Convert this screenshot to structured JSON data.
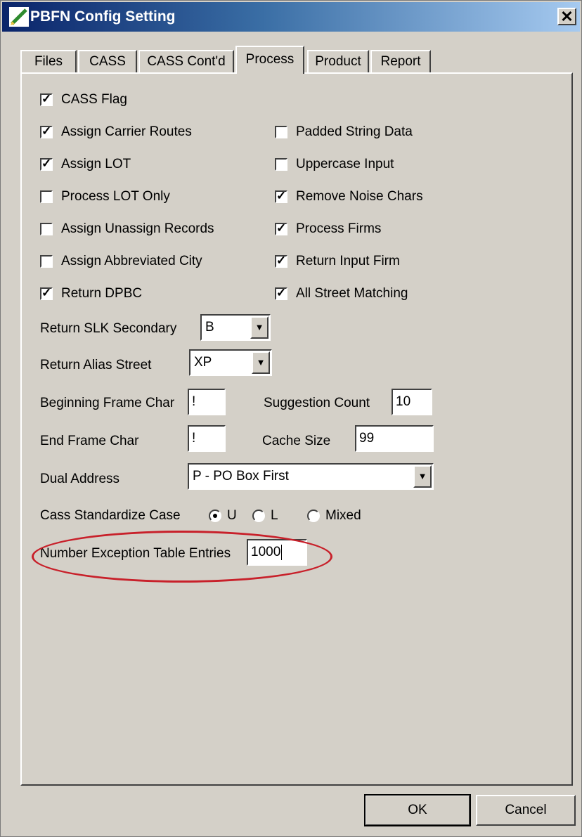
{
  "window": {
    "title": "PBFN Config Setting",
    "close_glyph": "✕"
  },
  "tabs": [
    {
      "label": "Files"
    },
    {
      "label": "CASS"
    },
    {
      "label": "CASS Cont'd"
    },
    {
      "label": "Process"
    },
    {
      "label": "Product"
    },
    {
      "label": "Report"
    }
  ],
  "active_tab": "Process",
  "checkboxes_left": [
    {
      "label": "CASS Flag",
      "checked": true,
      "mark": "✓"
    },
    {
      "label": "Assign Carrier Routes",
      "checked": true,
      "mark": "✓"
    },
    {
      "label": "Assign LOT",
      "checked": true,
      "mark": "✓"
    },
    {
      "label": "Process LOT Only",
      "checked": false,
      "mark": ""
    },
    {
      "label": "Assign Unassign Records",
      "checked": false,
      "mark": ""
    },
    {
      "label": "Assign Abbreviated City",
      "checked": false,
      "mark": ""
    },
    {
      "label": "Return DPBC",
      "checked": true,
      "mark": "✓"
    }
  ],
  "checkboxes_right": [
    {
      "label": "Padded String Data",
      "checked": false,
      "mark": ""
    },
    {
      "label": "Uppercase Input",
      "checked": false,
      "mark": ""
    },
    {
      "label": "Remove Noise Chars",
      "checked": true,
      "mark": "✓"
    },
    {
      "label": "Process Firms",
      "checked": true,
      "mark": "✓"
    },
    {
      "label": "Return Input Firm",
      "checked": true,
      "mark": "✓"
    },
    {
      "label": "All Street Matching",
      "checked": true,
      "mark": "✓"
    }
  ],
  "fields": {
    "return_slk_secondary": {
      "label": "Return SLK Secondary",
      "value": "B"
    },
    "return_alias_street": {
      "label": "Return Alias Street",
      "value": "XP"
    },
    "beginning_frame_char": {
      "label": "Beginning Frame Char",
      "value": "!"
    },
    "suggestion_count": {
      "label": "Suggestion Count",
      "value": "10"
    },
    "end_frame_char": {
      "label": "End Frame Char",
      "value": "!"
    },
    "cache_size": {
      "label": "Cache Size",
      "value": "99"
    },
    "dual_address": {
      "label": "Dual Address",
      "value": "P - PO Box First"
    },
    "number_exception_table_entries": {
      "label": "Number Exception Table Entries",
      "value": "1000"
    }
  },
  "cass_case": {
    "label": "Cass Standardize Case",
    "options": [
      {
        "label": "U",
        "selected": true
      },
      {
        "label": "L",
        "selected": false
      },
      {
        "label": "Mixed",
        "selected": false
      }
    ]
  },
  "combo_arrow": "▼",
  "buttons": {
    "ok": "OK",
    "cancel": "Cancel"
  },
  "colors": {
    "highlight": "#c8202a",
    "title_bar": "#0a246a",
    "dialog_face": "#d4d0c8"
  }
}
